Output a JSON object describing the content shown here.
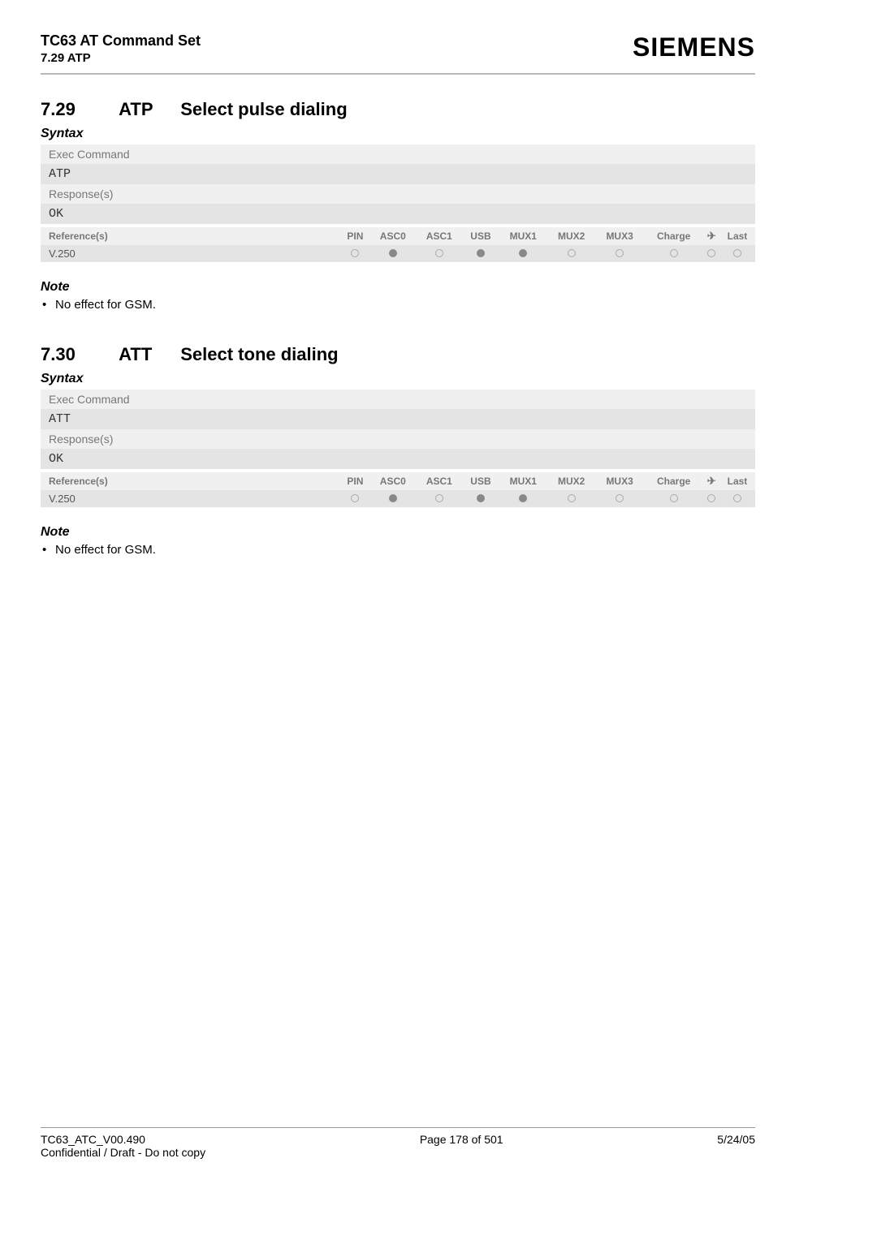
{
  "header": {
    "doc_title": "TC63 AT Command Set",
    "doc_section": "7.29 ATP",
    "brand": "SIEMENS"
  },
  "sections": [
    {
      "number": "7.29",
      "command": "ATP",
      "title": "Select pulse dialing",
      "syntax_label": "Syntax",
      "exec_label": "Exec Command",
      "exec_cmd": "ATP",
      "resp_label": "Response(s)",
      "resp_val": "OK",
      "ref_label": "Reference(s)",
      "ref_val": "V.250",
      "cols": [
        "PIN",
        "ASC0",
        "ASC1",
        "USB",
        "MUX1",
        "MUX2",
        "MUX3",
        "Charge",
        "✈",
        "Last"
      ],
      "dots": [
        "open",
        "filled",
        "open",
        "filled",
        "filled",
        "open",
        "open",
        "open",
        "open",
        "open"
      ],
      "note_label": "Note",
      "note_text": "No effect for GSM."
    },
    {
      "number": "7.30",
      "command": "ATT",
      "title": "Select tone dialing",
      "syntax_label": "Syntax",
      "exec_label": "Exec Command",
      "exec_cmd": "ATT",
      "resp_label": "Response(s)",
      "resp_val": "OK",
      "ref_label": "Reference(s)",
      "ref_val": "V.250",
      "cols": [
        "PIN",
        "ASC0",
        "ASC1",
        "USB",
        "MUX1",
        "MUX2",
        "MUX3",
        "Charge",
        "✈",
        "Last"
      ],
      "dots": [
        "open",
        "filled",
        "open",
        "filled",
        "filled",
        "open",
        "open",
        "open",
        "open",
        "open"
      ],
      "note_label": "Note",
      "note_text": "No effect for GSM."
    }
  ],
  "footer": {
    "left_line1": "TC63_ATC_V00.490",
    "left_line2": "Confidential / Draft - Do not copy",
    "mid": "Page 178 of 501",
    "right": "5/24/05"
  }
}
